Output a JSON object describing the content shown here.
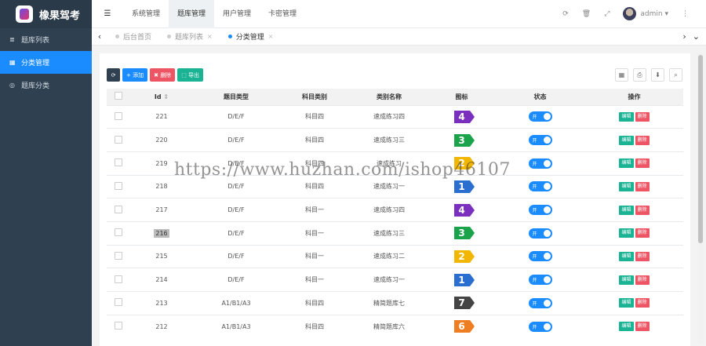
{
  "app": {
    "title": "橡果驾考"
  },
  "sidebar": {
    "items": [
      {
        "label": "题库列表",
        "icon": "list-icon",
        "active": false
      },
      {
        "label": "分类管理",
        "icon": "calendar-icon",
        "active": true
      },
      {
        "label": "题库分类",
        "icon": "target-icon",
        "active": false
      }
    ]
  },
  "topnav": {
    "items": [
      {
        "label": "系统管理",
        "active": false
      },
      {
        "label": "题库管理",
        "active": true
      },
      {
        "label": "用户管理",
        "active": false
      },
      {
        "label": "卡密管理",
        "active": false
      }
    ],
    "user": "admin"
  },
  "tabs": [
    {
      "label": "后台首页",
      "closable": false,
      "active": false
    },
    {
      "label": "题库列表",
      "closable": true,
      "active": false
    },
    {
      "label": "分类管理",
      "closable": true,
      "active": true
    }
  ],
  "toolbar": {
    "add_label": "添加",
    "delete_label": "删除",
    "export_label": "导出"
  },
  "table": {
    "headers": [
      "Id",
      "题目类型",
      "科目类别",
      "类别名称",
      "图标",
      "状态",
      "操作"
    ],
    "toggle_label": "开",
    "edit_label": "编辑",
    "delete_label": "删除",
    "rows": [
      {
        "id": "221",
        "type": "D/E/F",
        "subject": "科目四",
        "name": "速成练习四",
        "icon_num": "4",
        "icon_color": "#7b2fbf"
      },
      {
        "id": "220",
        "type": "D/E/F",
        "subject": "科目四",
        "name": "速成练习三",
        "icon_num": "3",
        "icon_color": "#1aa34a"
      },
      {
        "id": "219",
        "type": "D/E/F",
        "subject": "科目四",
        "name": "速成练习",
        "icon_num": "2",
        "icon_color": "#f2b705"
      },
      {
        "id": "218",
        "type": "D/E/F",
        "subject": "科目四",
        "name": "速成练习一",
        "icon_num": "1",
        "icon_color": "#2a6fd0"
      },
      {
        "id": "217",
        "type": "D/E/F",
        "subject": "科目一",
        "name": "速成练习四",
        "icon_num": "4",
        "icon_color": "#7b2fbf"
      },
      {
        "id": "216",
        "type": "D/E/F",
        "subject": "科目一",
        "name": "速成练习三",
        "icon_num": "3",
        "icon_color": "#1aa34a"
      },
      {
        "id": "215",
        "type": "D/E/F",
        "subject": "科目一",
        "name": "速成练习二",
        "icon_num": "2",
        "icon_color": "#f2b705"
      },
      {
        "id": "214",
        "type": "D/E/F",
        "subject": "科目一",
        "name": "速成练习一",
        "icon_num": "1",
        "icon_color": "#2a6fd0"
      },
      {
        "id": "213",
        "type": "A1/B1/A3",
        "subject": "科目四",
        "name": "精简题库七",
        "icon_num": "7",
        "icon_color": "#444444"
      },
      {
        "id": "212",
        "type": "A1/B1/A3",
        "subject": "科目四",
        "name": "精简题库六",
        "icon_num": "6",
        "icon_color": "#ef7d22"
      }
    ]
  },
  "watermark": "https://www.huzhan.com/ishop46107"
}
